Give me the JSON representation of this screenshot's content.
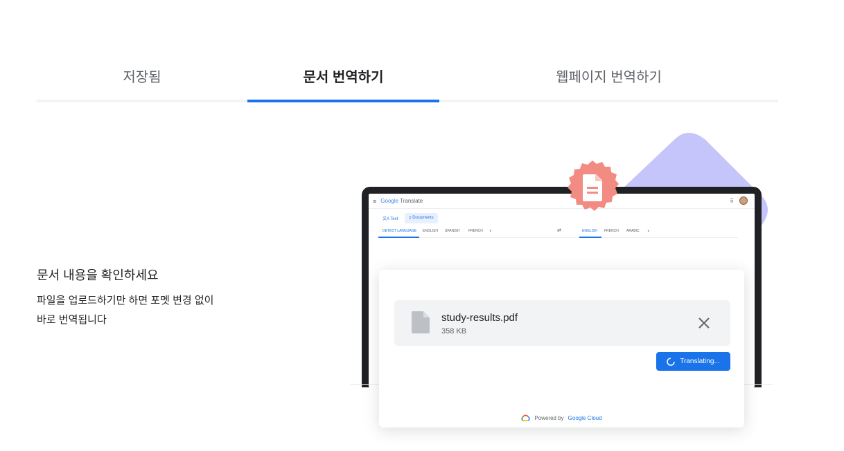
{
  "tabs": [
    {
      "label": "저장됨",
      "selected": false
    },
    {
      "label": "문서 번역하기",
      "selected": true
    },
    {
      "label": "웹페이지 번역하기",
      "selected": false
    }
  ],
  "content": {
    "heading": "문서 내용을 확인하세요",
    "description_line1": "파일을 업로드하기만 하면 포멧 변경 없이",
    "description_line2": "바로 번역됩니다"
  },
  "mockup": {
    "app_title_brand": "Google",
    "app_title_product": " Translate",
    "mode_text": "Text",
    "mode_documents": "Documents",
    "source_langs": [
      "DETECT LANGUAGE",
      "ENGLISH",
      "SPANISH",
      "FRENCH"
    ],
    "target_langs": [
      "ENGLISH",
      "FRENCH",
      "ARABIC"
    ]
  },
  "upload": {
    "file_name": "study-results.pdf",
    "file_size": "358 KB",
    "status_button": "Translating...",
    "powered_prefix": "Powered by",
    "powered_brand": "Google Cloud"
  },
  "colors": {
    "accent": "#1a73e8",
    "badge": "#f28b82",
    "blob": "#c5c5fb"
  },
  "icons": {
    "badge": "document-icon",
    "file": "file-icon",
    "close": "close-icon",
    "spinner": "spinner-icon",
    "cloud": "google-cloud-icon"
  }
}
